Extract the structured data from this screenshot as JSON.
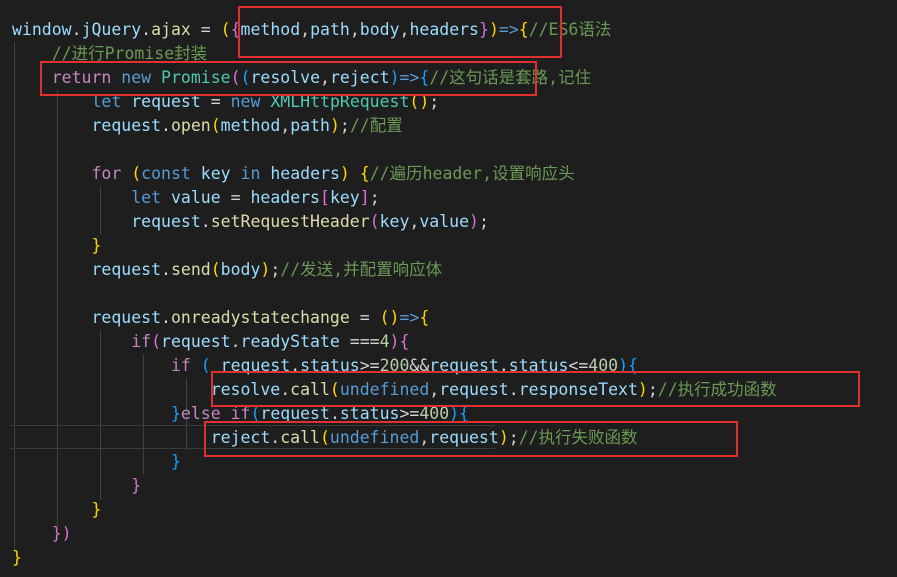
{
  "editor": {
    "language": "javascript",
    "theme": "dark",
    "lines": [
      [
        [
          "window",
          "var"
        ],
        [
          ".",
          "op"
        ],
        [
          "jQuery",
          "var"
        ],
        [
          ".",
          "op"
        ],
        [
          "ajax",
          "fn"
        ],
        [
          " = ",
          "op"
        ],
        [
          "(",
          "p1"
        ],
        [
          "{",
          "p2"
        ],
        [
          "method",
          "var"
        ],
        [
          ",",
          "op"
        ],
        [
          "path",
          "var"
        ],
        [
          ",",
          "op"
        ],
        [
          "body",
          "var"
        ],
        [
          ",",
          "op"
        ],
        [
          "headers",
          "var"
        ],
        [
          "}",
          "p2"
        ],
        [
          ")",
          "p1"
        ],
        [
          "=>",
          "kw"
        ],
        [
          "{",
          "p1"
        ],
        [
          "//ES6语法",
          "cm"
        ]
      ],
      [
        [
          "    //进行Promise封装",
          "cm"
        ]
      ],
      [
        [
          "    ",
          "op"
        ],
        [
          "return",
          "ctrl"
        ],
        [
          " ",
          "op"
        ],
        [
          "new",
          "kw"
        ],
        [
          " ",
          "op"
        ],
        [
          "Promise",
          "cls"
        ],
        [
          "(",
          "p2"
        ],
        [
          "(",
          "p3"
        ],
        [
          "resolve",
          "var"
        ],
        [
          ",",
          "op"
        ],
        [
          "reject",
          "var"
        ],
        [
          ")",
          "p3"
        ],
        [
          "=>",
          "kw"
        ],
        [
          "{",
          "p3"
        ],
        [
          "//这句话是套路,记住",
          "cm"
        ]
      ],
      [
        [
          "        ",
          "op"
        ],
        [
          "let",
          "kw"
        ],
        [
          " ",
          "op"
        ],
        [
          "request",
          "var"
        ],
        [
          " = ",
          "op"
        ],
        [
          "new",
          "kw"
        ],
        [
          " ",
          "op"
        ],
        [
          "XMLHttpRequest",
          "cls"
        ],
        [
          "(",
          "p1"
        ],
        [
          ")",
          "p1"
        ],
        [
          ";",
          "op"
        ]
      ],
      [
        [
          "        ",
          "op"
        ],
        [
          "request",
          "var"
        ],
        [
          ".",
          "op"
        ],
        [
          "open",
          "fn"
        ],
        [
          "(",
          "p1"
        ],
        [
          "method",
          "var"
        ],
        [
          ",",
          "op"
        ],
        [
          "path",
          "var"
        ],
        [
          ")",
          "p1"
        ],
        [
          ";",
          "op"
        ],
        [
          "//配置",
          "cm"
        ]
      ],
      [
        [
          " ",
          "op"
        ]
      ],
      [
        [
          "        ",
          "op"
        ],
        [
          "for",
          "ctrl"
        ],
        [
          " ",
          "op"
        ],
        [
          "(",
          "p1"
        ],
        [
          "const",
          "kw"
        ],
        [
          " ",
          "op"
        ],
        [
          "key",
          "var"
        ],
        [
          " ",
          "op"
        ],
        [
          "in",
          "kw"
        ],
        [
          " ",
          "op"
        ],
        [
          "headers",
          "var"
        ],
        [
          ")",
          "p1"
        ],
        [
          " ",
          "op"
        ],
        [
          "{",
          "p1"
        ],
        [
          "//遍历header,设置响应头",
          "cm"
        ]
      ],
      [
        [
          "            ",
          "op"
        ],
        [
          "let",
          "kw"
        ],
        [
          " ",
          "op"
        ],
        [
          "value",
          "var"
        ],
        [
          " = ",
          "op"
        ],
        [
          "headers",
          "var"
        ],
        [
          "[",
          "p2"
        ],
        [
          "key",
          "var"
        ],
        [
          "]",
          "p2"
        ],
        [
          ";",
          "op"
        ]
      ],
      [
        [
          "            ",
          "op"
        ],
        [
          "request",
          "var"
        ],
        [
          ".",
          "op"
        ],
        [
          "setRequestHeader",
          "fn"
        ],
        [
          "(",
          "p2"
        ],
        [
          "key",
          "var"
        ],
        [
          ",",
          "op"
        ],
        [
          "value",
          "var"
        ],
        [
          ")",
          "p2"
        ],
        [
          ";",
          "op"
        ]
      ],
      [
        [
          "        ",
          "op"
        ],
        [
          "}",
          "p1"
        ]
      ],
      [
        [
          "        ",
          "op"
        ],
        [
          "request",
          "var"
        ],
        [
          ".",
          "op"
        ],
        [
          "send",
          "fn"
        ],
        [
          "(",
          "p1"
        ],
        [
          "body",
          "var"
        ],
        [
          ")",
          "p1"
        ],
        [
          ";",
          "op"
        ],
        [
          "//发送,并配置响应体",
          "cm"
        ]
      ],
      [
        [
          " ",
          "op"
        ]
      ],
      [
        [
          "        ",
          "op"
        ],
        [
          "request",
          "var"
        ],
        [
          ".",
          "op"
        ],
        [
          "onreadystatechange",
          "fn"
        ],
        [
          " = ",
          "op"
        ],
        [
          "(",
          "p1"
        ],
        [
          ")",
          "p1"
        ],
        [
          "=>",
          "kw"
        ],
        [
          "{",
          "p1"
        ]
      ],
      [
        [
          "            ",
          "op"
        ],
        [
          "if",
          "ctrl"
        ],
        [
          "(",
          "p2"
        ],
        [
          "request",
          "var"
        ],
        [
          ".",
          "op"
        ],
        [
          "readyState",
          "var"
        ],
        [
          " ===",
          "op"
        ],
        [
          "4",
          "num"
        ],
        [
          ")",
          "p2"
        ],
        [
          "{",
          "p2"
        ]
      ],
      [
        [
          "                ",
          "op"
        ],
        [
          "if",
          "ctrl"
        ],
        [
          " ",
          "op"
        ],
        [
          "(",
          "p3"
        ],
        [
          " ",
          "op"
        ],
        [
          "request",
          "var"
        ],
        [
          ".",
          "op"
        ],
        [
          "status",
          "var"
        ],
        [
          ">=",
          "op"
        ],
        [
          "200",
          "num"
        ],
        [
          "&&",
          "op"
        ],
        [
          "request",
          "var"
        ],
        [
          ".",
          "op"
        ],
        [
          "status",
          "var"
        ],
        [
          "<=",
          "op"
        ],
        [
          "400",
          "num"
        ],
        [
          ")",
          "p3"
        ],
        [
          "{",
          "p3"
        ]
      ],
      [
        [
          "                    ",
          "op"
        ],
        [
          "resolve",
          "var"
        ],
        [
          ".",
          "op"
        ],
        [
          "call",
          "fn"
        ],
        [
          "(",
          "p1"
        ],
        [
          "undefined",
          "kw"
        ],
        [
          ",",
          "op"
        ],
        [
          "request",
          "var"
        ],
        [
          ".",
          "op"
        ],
        [
          "responseText",
          "var"
        ],
        [
          ")",
          "p1"
        ],
        [
          ";",
          "op"
        ],
        [
          "//执行成功函数",
          "cm"
        ]
      ],
      [
        [
          "                ",
          "op"
        ],
        [
          "}",
          "p3"
        ],
        [
          "else",
          "ctrl"
        ],
        [
          " ",
          "op"
        ],
        [
          "if",
          "ctrl"
        ],
        [
          "(",
          "p3"
        ],
        [
          "request",
          "var"
        ],
        [
          ".",
          "op"
        ],
        [
          "status",
          "var"
        ],
        [
          ">=",
          "op"
        ],
        [
          "400",
          "num"
        ],
        [
          ")",
          "p3"
        ],
        [
          "{",
          "p3"
        ]
      ],
      [
        [
          "                    ",
          "op"
        ],
        [
          "reject",
          "var"
        ],
        [
          ".",
          "op"
        ],
        [
          "call",
          "fn"
        ],
        [
          "(",
          "p1"
        ],
        [
          "undefined",
          "kw"
        ],
        [
          ",",
          "op"
        ],
        [
          "request",
          "var"
        ],
        [
          ")",
          "p1"
        ],
        [
          ";",
          "op"
        ],
        [
          "//执行失败函数",
          "cm"
        ]
      ],
      [
        [
          "                ",
          "op"
        ],
        [
          "}",
          "p3"
        ]
      ],
      [
        [
          "            ",
          "op"
        ],
        [
          "}",
          "p2"
        ]
      ],
      [
        [
          "        ",
          "op"
        ],
        [
          "}",
          "p1"
        ]
      ],
      [
        [
          "    ",
          "op"
        ],
        [
          "})",
          "p2"
        ]
      ],
      [
        [
          "}",
          "p1"
        ]
      ]
    ]
  },
  "annotations": {
    "color": "#e03131",
    "boxes": [
      "params-destructure",
      "promise-return",
      "resolve-call",
      "reject-call"
    ]
  }
}
